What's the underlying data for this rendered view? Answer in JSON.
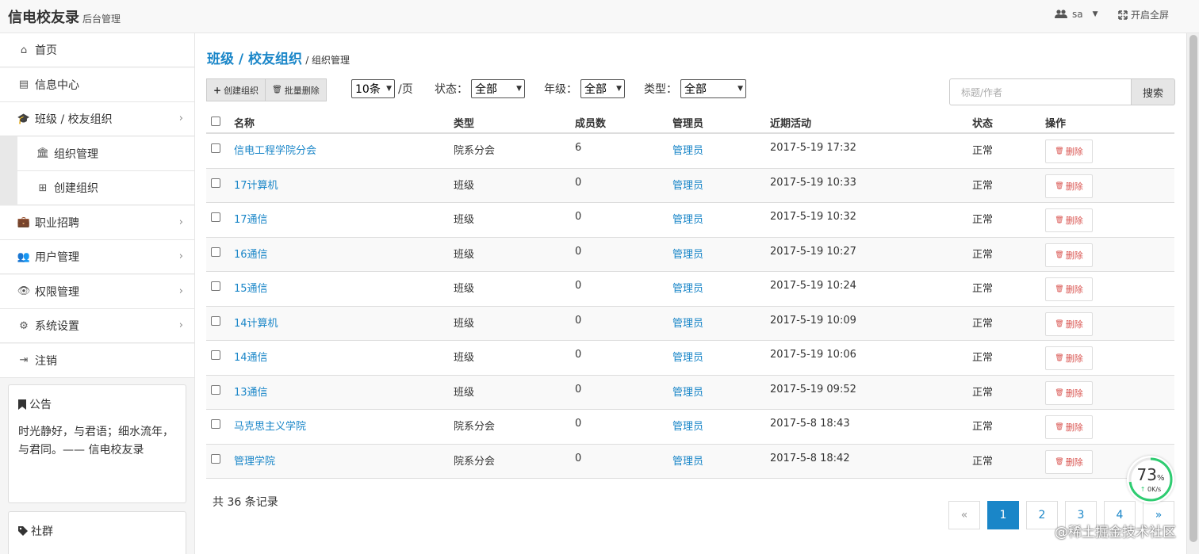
{
  "header": {
    "brand": "信电校友录",
    "brand_sub": "后台管理",
    "user_name": "sa",
    "fullscreen_label": "开启全屏"
  },
  "sidebar": {
    "items": [
      {
        "label": "首页",
        "icon": "home-icon"
      },
      {
        "label": "信息中心",
        "icon": "newspaper-icon"
      },
      {
        "label": "班级 / 校友组织",
        "icon": "graduation-cap-icon"
      },
      {
        "label": "组织管理",
        "icon": "institution-icon"
      },
      {
        "label": "创建组织",
        "icon": "plus-square-icon"
      },
      {
        "label": "职业招聘",
        "icon": "briefcase-icon"
      },
      {
        "label": "用户管理",
        "icon": "users-icon"
      },
      {
        "label": "权限管理",
        "icon": "eye-icon"
      },
      {
        "label": "系统设置",
        "icon": "gears-icon"
      },
      {
        "label": "注销",
        "icon": "sign-out-icon"
      }
    ],
    "notice_title": "公告",
    "notice_text": "时光静好，与君语；细水流年，与君同。—— 信电校友录",
    "community_title": "社群"
  },
  "main": {
    "breadcrumb_title": "班级 / 校友组织",
    "breadcrumb_sub": "/ 组织管理",
    "create_button": "创建组织",
    "batch_delete_button": "批量删除",
    "page_size_value": "10条",
    "page_size_suffix": "/页",
    "status_label": "状态：",
    "status_value": "全部",
    "grade_label": "年级：",
    "grade_value": "全部",
    "type_label": "类型：",
    "type_value": "全部",
    "search_placeholder": "标题/作者",
    "search_button": "搜索",
    "columns": [
      "名称",
      "类型",
      "成员数",
      "管理员",
      "近期活动",
      "状态",
      "操作"
    ],
    "rows": [
      {
        "name": "信电工程学院分会",
        "type": "院系分会",
        "members": "6",
        "admin": "管理员",
        "activity": "2017-5-19 17:32",
        "status": "正常",
        "action": "删除"
      },
      {
        "name": "17计算机",
        "type": "班级",
        "members": "0",
        "admin": "管理员",
        "activity": "2017-5-19 10:33",
        "status": "正常",
        "action": "删除"
      },
      {
        "name": "17通信",
        "type": "班级",
        "members": "0",
        "admin": "管理员",
        "activity": "2017-5-19 10:32",
        "status": "正常",
        "action": "删除"
      },
      {
        "name": "16通信",
        "type": "班级",
        "members": "0",
        "admin": "管理员",
        "activity": "2017-5-19 10:27",
        "status": "正常",
        "action": "删除"
      },
      {
        "name": "15通信",
        "type": "班级",
        "members": "0",
        "admin": "管理员",
        "activity": "2017-5-19 10:24",
        "status": "正常",
        "action": "删除"
      },
      {
        "name": "14计算机",
        "type": "班级",
        "members": "0",
        "admin": "管理员",
        "activity": "2017-5-19 10:09",
        "status": "正常",
        "action": "删除"
      },
      {
        "name": "14通信",
        "type": "班级",
        "members": "0",
        "admin": "管理员",
        "activity": "2017-5-19 10:06",
        "status": "正常",
        "action": "删除"
      },
      {
        "name": "13通信",
        "type": "班级",
        "members": "0",
        "admin": "管理员",
        "activity": "2017-5-19 09:52",
        "status": "正常",
        "action": "删除"
      },
      {
        "name": "马克思主义学院",
        "type": "院系分会",
        "members": "0",
        "admin": "管理员",
        "activity": "2017-5-8 18:43",
        "status": "正常",
        "action": "删除"
      },
      {
        "name": "管理学院",
        "type": "院系分会",
        "members": "0",
        "admin": "管理员",
        "activity": "2017-5-8 18:42",
        "status": "正常",
        "action": "删除"
      }
    ],
    "total_text": "共 36 条记录",
    "pager": [
      "«",
      "1",
      "2",
      "3",
      "4",
      "»"
    ],
    "active_page": "1"
  },
  "overlay": {
    "gauge_percent": "73",
    "gauge_unit": "%",
    "gauge_speed": "0K/s",
    "watermark": "@稀土掘金技术社区"
  },
  "colors": {
    "accent": "#1a86c8",
    "danger": "#d9534f",
    "gauge_green": "#2ecc71"
  }
}
